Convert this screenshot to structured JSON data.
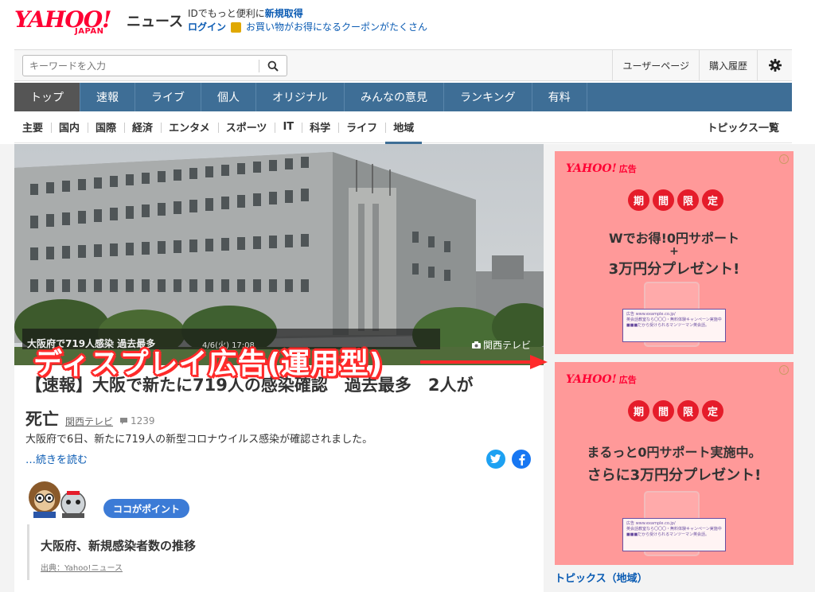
{
  "brand": {
    "logo_main": "YAHOO!",
    "logo_sub": "JAPAN",
    "site": "ニュース"
  },
  "promo": {
    "line1_prefix": "IDでもっと便利に",
    "line1_link": "新規取得",
    "login": "ログイン",
    "coupon": "お買い物がお得になるクーポンがたくさん"
  },
  "search": {
    "placeholder": "キーワードを入力"
  },
  "toolbar": {
    "user_page": "ユーザーページ",
    "purchase_history": "購入履歴"
  },
  "main_tabs": [
    {
      "label": "トップ"
    },
    {
      "label": "速報"
    },
    {
      "label": "ライブ"
    },
    {
      "label": "個人"
    },
    {
      "label": "オリジナル"
    },
    {
      "label": "みんなの意見"
    },
    {
      "label": "ランキング"
    },
    {
      "label": "有料"
    }
  ],
  "sub_tabs": [
    {
      "label": "主要"
    },
    {
      "label": "国内"
    },
    {
      "label": "国際"
    },
    {
      "label": "経済"
    },
    {
      "label": "エンタメ"
    },
    {
      "label": "スポーツ"
    },
    {
      "label": "IT"
    },
    {
      "label": "科学"
    },
    {
      "label": "ライフ"
    },
    {
      "label": "地域"
    }
  ],
  "topics_all": "トピックス一覧",
  "article": {
    "caption": "大阪府で719人感染 過去最多",
    "caption_time": "4/6(火) 17:08",
    "photo_source": "関西テレビ",
    "headline": "【速報】大阪で新たに719人の感染確認　過去最多　2人が",
    "headline_tail": "死亡",
    "source": "関西テレビ",
    "comments": "1239",
    "summary": "大阪府で6日、新たに719人の新型コロナウイルス感染が確認されました。",
    "read_more": "…続きを読む",
    "point_label": "ココがポイント",
    "point_title": "大阪府、新規感染者数の推移",
    "point_source": "出典：Yahoo!ニュース"
  },
  "overlay": {
    "label": "ディスプレイ広告(運用型)"
  },
  "ads": [
    {
      "brand": "YAHOO!",
      "brand_suffix": "広告",
      "limited": [
        "期",
        "間",
        "限",
        "定"
      ],
      "line1": "Wでお得!0円サポート",
      "plus": "+",
      "line2": "3万円分プレゼント!",
      "card_url": "広告 www.example.co.jp/",
      "card_l1": "英会話教室なら〇〇〇・無料体験キャンペーン実施中",
      "card_l2": "■■■だから受けられるマンツーマン英会話。"
    },
    {
      "brand": "YAHOO!",
      "brand_suffix": "広告",
      "limited": [
        "期",
        "間",
        "限",
        "定"
      ],
      "line1": "まるっと0円サポート実施中。",
      "line2": "さらに3万円分プレゼント!",
      "card_url": "広告 www.example.co.jp/",
      "card_l1": "英会話教室なら〇〇〇・無料体験キャンペーン実施中",
      "card_l2": "■■■だから受けられるマンツーマン英会話。"
    }
  ],
  "sidebar_topics": "トピックス（地域）",
  "colors": {
    "nav_bg": "#3e6e96",
    "brand_red": "#ff0033",
    "ad_bg": "#ff9999",
    "link": "#0a5bb3"
  }
}
